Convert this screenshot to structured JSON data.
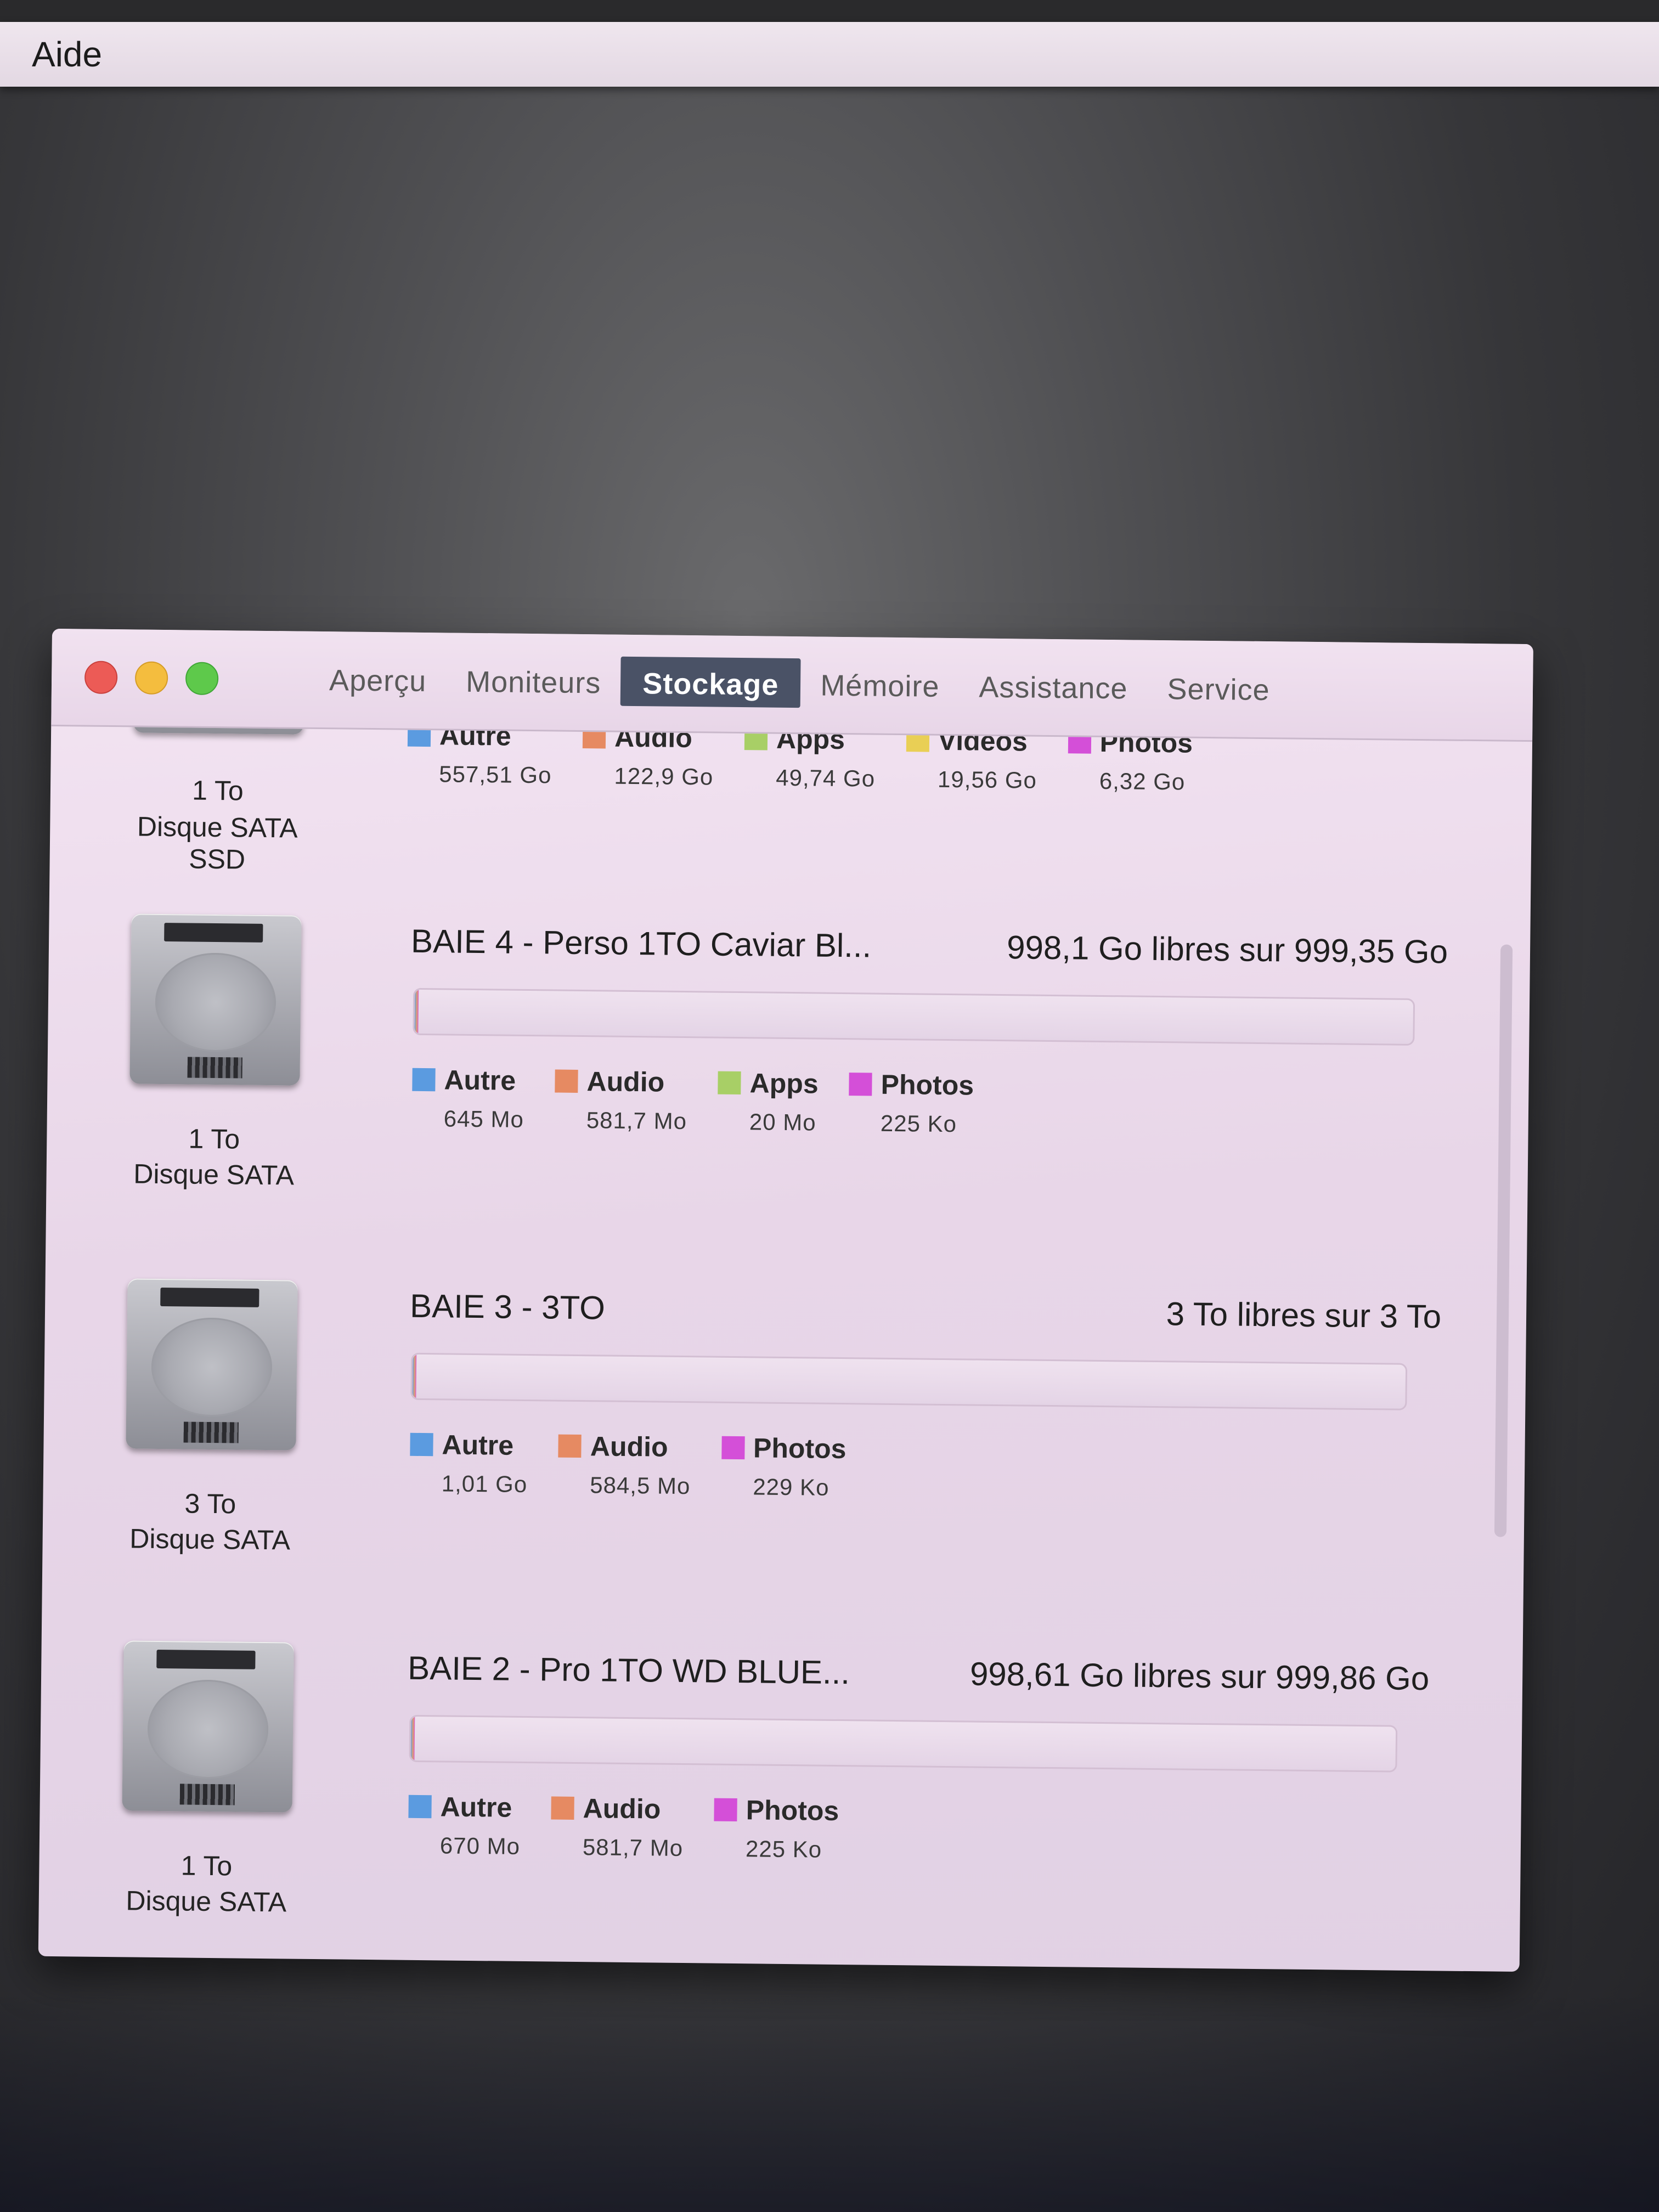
{
  "menubar": {
    "help": "Aide"
  },
  "window": {
    "tabs": [
      {
        "label": "Aperçu",
        "active": false
      },
      {
        "label": "Moniteurs",
        "active": false
      },
      {
        "label": "Stockage",
        "active": true
      },
      {
        "label": "Mémoire",
        "active": false
      },
      {
        "label": "Assistance",
        "active": false
      },
      {
        "label": "Service",
        "active": false
      }
    ]
  },
  "colors": {
    "autre": "#5b9be0",
    "audio": "#e68a62",
    "apps": "#a8cf66",
    "videos": "#e9cf55",
    "photos": "#d44fd8"
  },
  "drives": [
    {
      "size": "1 To",
      "type": "Disque SATA SSD",
      "legend": [
        {
          "name": "Autre",
          "value": "557,51 Go",
          "color": "autre"
        },
        {
          "name": "Audio",
          "value": "122,9 Go",
          "color": "audio"
        },
        {
          "name": "Apps",
          "value": "49,74 Go",
          "color": "apps"
        },
        {
          "name": "Vidéos",
          "value": "19,56 Go",
          "color": "videos"
        },
        {
          "name": "Photos",
          "value": "6,32 Go",
          "color": "photos"
        }
      ]
    },
    {
      "size": "1 To",
      "type": "Disque SATA",
      "title": "BAIE 4 - Perso 1TO Caviar Bl...",
      "free": "998,1 Go libres sur 999,35 Go",
      "used_fraction": 0.002,
      "legend": [
        {
          "name": "Autre",
          "value": "645 Mo",
          "color": "autre"
        },
        {
          "name": "Audio",
          "value": "581,7 Mo",
          "color": "audio"
        },
        {
          "name": "Apps",
          "value": "20 Mo",
          "color": "apps"
        },
        {
          "name": "Photos",
          "value": "225 Ko",
          "color": "photos"
        }
      ]
    },
    {
      "size": "3 To",
      "type": "Disque SATA",
      "title": "BAIE 3 - 3TO",
      "free": "3 To libres sur 3 To",
      "used_fraction": 0.001,
      "legend": [
        {
          "name": "Autre",
          "value": "1,01 Go",
          "color": "autre"
        },
        {
          "name": "Audio",
          "value": "584,5 Mo",
          "color": "audio"
        },
        {
          "name": "Photos",
          "value": "229 Ko",
          "color": "photos"
        }
      ]
    },
    {
      "size": "1 To",
      "type": "Disque SATA",
      "title": "BAIE 2 - Pro 1TO WD BLUE...",
      "free": "998,61 Go libres sur 999,86 Go",
      "used_fraction": 0.002,
      "legend": [
        {
          "name": "Autre",
          "value": "670 Mo",
          "color": "autre"
        },
        {
          "name": "Audio",
          "value": "581,7 Mo",
          "color": "audio"
        },
        {
          "name": "Photos",
          "value": "225 Ko",
          "color": "photos"
        }
      ]
    }
  ]
}
